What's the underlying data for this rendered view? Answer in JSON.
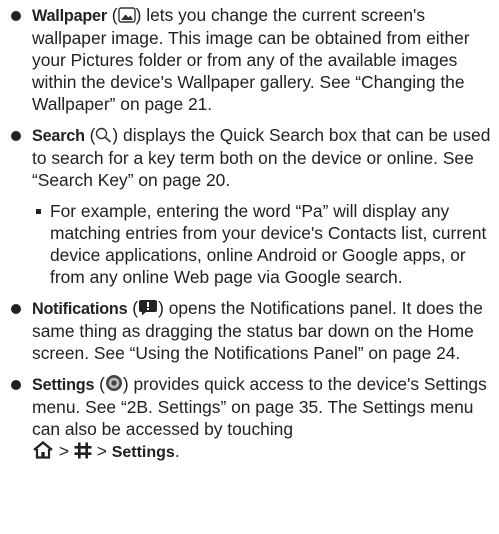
{
  "items": [
    {
      "term": "Wallpaper",
      "icon": "wallpaper-icon",
      "text": "lets you change the current screen's wallpaper image. This image can be obtained from either your Pictures folder or from any of the available images within the device's Wallpaper gallery. See “Changing the Wallpaper” on page 21."
    },
    {
      "term": "Search",
      "icon": "search-icon",
      "text": "displays the Quick Search box that can be used to search for a key term both on the device or online. See “Search Key” on page 20.",
      "sub": "For example, entering the word “Pa” will display any matching entries from your device's Contacts list, current device applications, online Android or Google apps, or from any online Web page via Google search."
    },
    {
      "term": "Notifications",
      "icon": "notifications-icon",
      "text": "opens the Notifications panel. It does the same thing as dragging the status bar down on the Home screen. See “Using the Notifications Panel” on page 24."
    },
    {
      "term": "Settings",
      "icon": "settings-icon",
      "text": "provides quick access to the device's Settings menu. See “2B. Settings” on page 35. The Settings menu can also be accessed by touching",
      "path_sep": ">",
      "path_end": "Settings",
      "path_end_suffix": ".",
      "path_icons": [
        "home-icon",
        "menu-grid-icon"
      ]
    }
  ],
  "punct": {
    "open": " (",
    "close": ") "
  }
}
